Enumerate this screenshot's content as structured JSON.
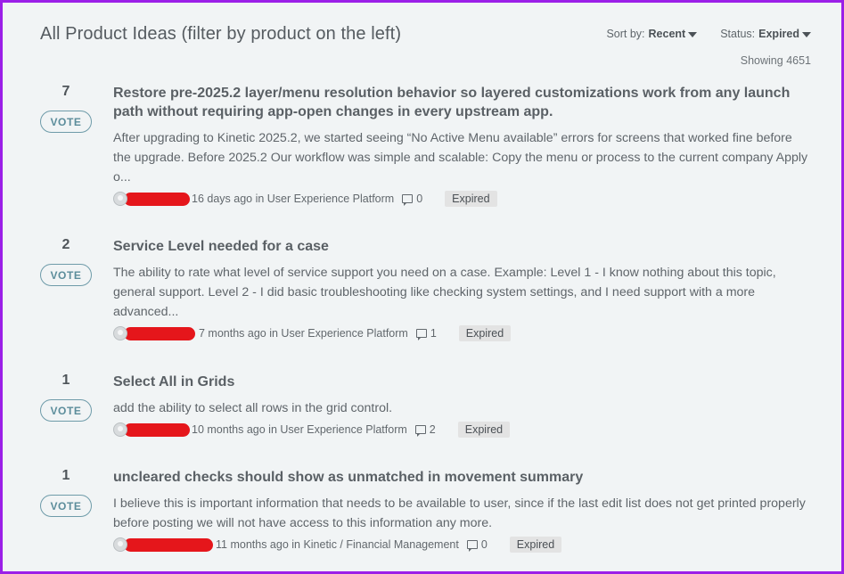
{
  "header": {
    "title": "All Product Ideas (filter by product on the left)",
    "sort_label": "Sort by:",
    "sort_value": "Recent",
    "status_label": "Status:",
    "status_value": "Expired",
    "showing": "Showing 4651"
  },
  "vote_label": "VOTE",
  "ideas": [
    {
      "votes": "7",
      "title": "Restore pre-2025.2 layer/menu resolution behavior so layered customizations work from any launch path without requiring app-open changes in every upstream app.",
      "description": "After upgrading to Kinetic 2025.2, we started seeing “No Active Menu available” errors for screens that worked fine before the upgrade. Before 2025.2 Our workflow was simple and scalable: Copy the menu or process to the current company Apply o...",
      "meta": "16 days ago in User Experience Platform",
      "comments": "0",
      "status": "Expired"
    },
    {
      "votes": "2",
      "title": "Service Level needed for a case",
      "description": "The ability to rate what level of service support you need on a case. Example: Level 1 - I know nothing about this topic, general support. Level 2 - I did basic troubleshooting like checking system settings, and I need support with a more advanced...",
      "meta": "7 months ago in User Experience Platform",
      "comments": "1",
      "status": "Expired"
    },
    {
      "votes": "1",
      "title": "Select All in Grids",
      "description": "add the ability to select all rows in the grid control.",
      "meta": "10 months ago in User Experience Platform",
      "comments": "2",
      "status": "Expired"
    },
    {
      "votes": "1",
      "title": "uncleared checks should show as unmatched in movement summary",
      "description": "I believe this is important information that needs to be available to user, since if the last edit list does not get printed properly before posting we will not have access to this information any more.",
      "meta": "11 months ago in Kinetic / Financial Management",
      "comments": "0",
      "status": "Expired"
    }
  ]
}
